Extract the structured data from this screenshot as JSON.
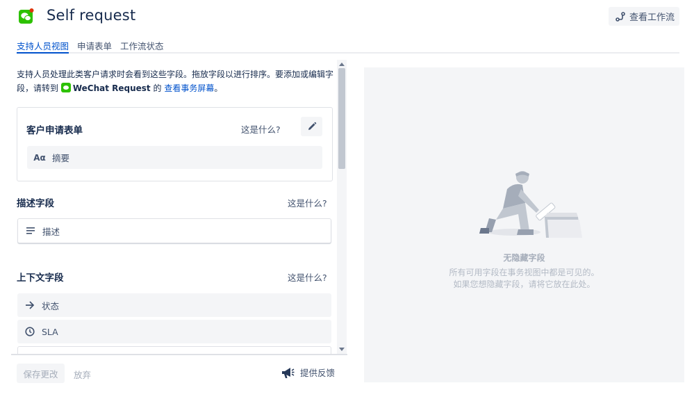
{
  "header": {
    "title": "Self request",
    "workflow_button": "查看工作流"
  },
  "tabs": [
    {
      "label": "支持人员视图",
      "active": true
    },
    {
      "label": "申请表单",
      "active": false
    },
    {
      "label": "工作流状态",
      "active": false
    }
  ],
  "intro": {
    "text_1": "支持人员处理此类客户请求时会看到这些字段。拖放字段以进行排序。要添加或编辑字段，请转到 ",
    "project_name": "WeChat Request",
    "text_2": " 的 ",
    "link": "查看事务屏幕",
    "text_3": "。"
  },
  "request_form_card": {
    "title": "客户申请表单",
    "what_link": "这是什么?",
    "field_icon": "Aα",
    "field_label": "摘要"
  },
  "description_section": {
    "title": "描述字段",
    "what_link": "这是什么?",
    "field_label": "描述"
  },
  "context_section": {
    "title": "上下文字段",
    "what_link": "这是什么?",
    "fields": [
      {
        "label": "状态",
        "icon": "arrow-right-icon"
      },
      {
        "label": "SLA",
        "icon": "clock-icon"
      }
    ]
  },
  "footer": {
    "save_label": "保存更改",
    "discard_label": "放弃",
    "feedback_label": "提供反馈"
  },
  "hidden_panel": {
    "title": "无隐藏字段",
    "desc_line_1": "所有可用字段在事务视图中都是可见的。",
    "desc_line_2": "如果您想隐藏字段，请将它放在此处。"
  },
  "colors": {
    "accent": "#0052cc",
    "text": "#172b4d",
    "subtle_text": "#42526e",
    "panel_bg": "#f4f5f7",
    "wechat_green": "#2dc100"
  }
}
